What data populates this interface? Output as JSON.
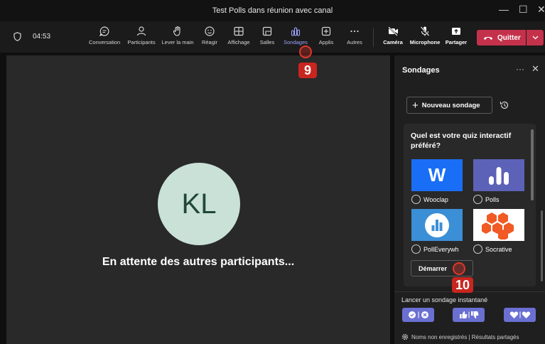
{
  "window": {
    "title": "Test Polls dans réunion avec canal",
    "minimize_glyph": "—",
    "maximize_glyph": "☐",
    "close_glyph": "✕"
  },
  "toolbar": {
    "timer": "04:53",
    "items": [
      {
        "label": "Conversation",
        "icon": "chat-icon"
      },
      {
        "label": "Participants",
        "icon": "people-icon"
      },
      {
        "label": "Lever la main",
        "icon": "raise-hand-icon"
      },
      {
        "label": "Réagir",
        "icon": "emoji-icon"
      },
      {
        "label": "Affichage",
        "icon": "layout-icon"
      },
      {
        "label": "Salles",
        "icon": "rooms-icon"
      },
      {
        "label": "Sondages",
        "icon": "polls-icon",
        "active": true
      },
      {
        "label": "Applis",
        "icon": "apps-add-icon"
      },
      {
        "label": "Autres",
        "icon": "more-icon"
      }
    ],
    "media": [
      {
        "label": "Caméra",
        "icon": "camera-off-icon"
      },
      {
        "label": "Microphone",
        "icon": "mic-off-icon"
      },
      {
        "label": "Partager",
        "icon": "share-screen-icon"
      }
    ],
    "leave_label": "Quitter",
    "accent_active": "#9ea2ff",
    "leave_color": "#c4314b"
  },
  "stage": {
    "avatar_initials": "KL",
    "waiting_text": "En attente des autres participants..."
  },
  "panel": {
    "title": "Sondages",
    "more_glyph": "···",
    "close_glyph": "✕",
    "new_poll_label": "Nouveau sondage",
    "quiz": {
      "question": "Quel est votre quiz interactif préféré?",
      "options": [
        {
          "name": "Wooclap",
          "logo_text": "W",
          "logo_color": "#1a6ef5"
        },
        {
          "name": "Polls",
          "logo_color": "#5c62b8"
        },
        {
          "name": "PollEverywh",
          "logo_color": "#3b8fd6"
        },
        {
          "name": "Socrative",
          "logo_color": "#f15a24"
        }
      ],
      "start_label": "Démarrer"
    },
    "instant_label": "Lancer un sondage instantané",
    "footer_text": "Noms non enregistrés | Résultats partagés"
  },
  "annotations": {
    "step_9": "9",
    "step_10": "10",
    "color": "#c8261f"
  }
}
